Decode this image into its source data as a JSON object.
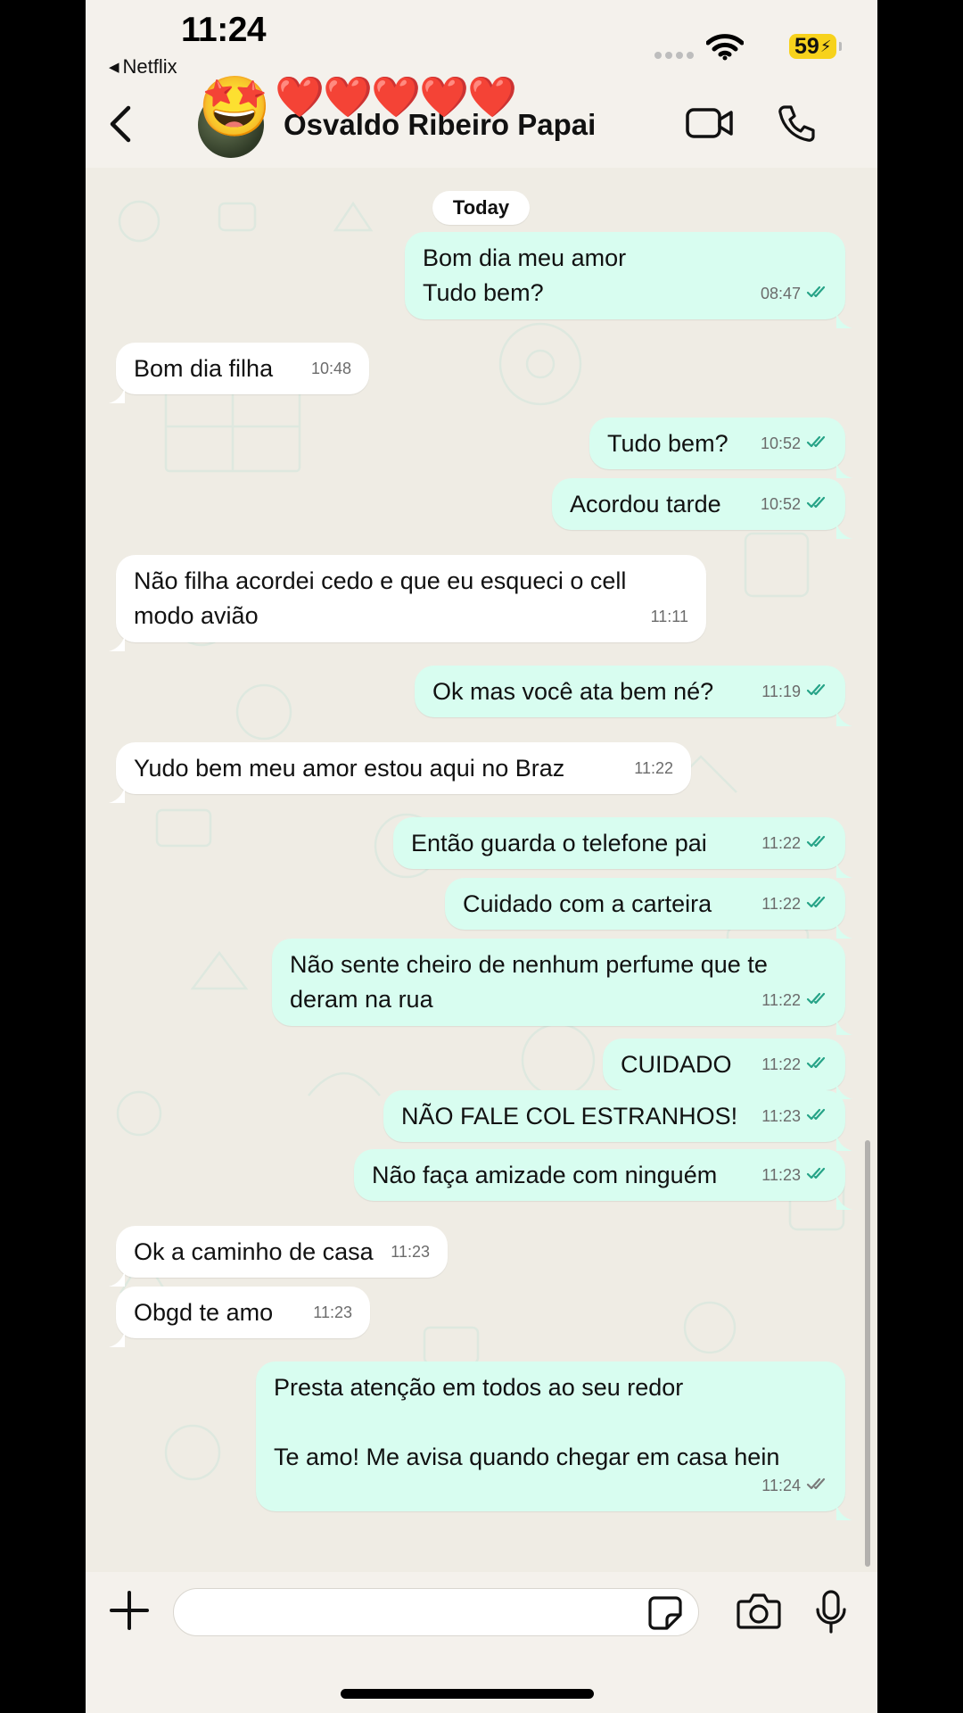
{
  "status_bar": {
    "time": "11:24",
    "back_app": "Netflix",
    "battery": "59"
  },
  "header": {
    "contact_name": "Osvaldo Ribeiro Papai",
    "hearts": "❤️❤️❤️❤️❤️",
    "avatar_emoji": "🤩"
  },
  "chat": {
    "date_label": "Today",
    "messages": [
      {
        "dir": "out",
        "lines": [
          "Bom dia meu amor",
          "Tudo bem?"
        ],
        "time": "08:47"
      },
      {
        "dir": "in",
        "lines": [
          "Bom dia filha"
        ],
        "time": "10:48"
      },
      {
        "dir": "out",
        "lines": [
          "Tudo bem?"
        ],
        "time": "10:52"
      },
      {
        "dir": "out",
        "lines": [
          "Acordou tarde"
        ],
        "time": "10:52"
      },
      {
        "dir": "in",
        "lines": [
          "Não filha acordei cedo e que eu esqueci o cell",
          "modo avião"
        ],
        "time": "11:11"
      },
      {
        "dir": "out",
        "lines": [
          "Ok mas você ata bem né?"
        ],
        "time": "11:19"
      },
      {
        "dir": "in",
        "lines": [
          "Yudo bem meu amor estou aqui no Braz"
        ],
        "time": "11:22"
      },
      {
        "dir": "out",
        "lines": [
          "Então guarda o telefone pai"
        ],
        "time": "11:22"
      },
      {
        "dir": "out",
        "lines": [
          "Cuidado com a carteira"
        ],
        "time": "11:22"
      },
      {
        "dir": "out",
        "lines": [
          "Não sente cheiro de nenhum perfume que te",
          "deram na rua"
        ],
        "time": "11:22"
      },
      {
        "dir": "out",
        "lines": [
          "CUIDADO"
        ],
        "time": "11:22"
      },
      {
        "dir": "out",
        "lines": [
          "NÃO FALE COL ESTRANHOS!"
        ],
        "time": "11:23"
      },
      {
        "dir": "out",
        "lines": [
          "Não faça amizade com ninguém"
        ],
        "time": "11:23"
      },
      {
        "dir": "in",
        "lines": [
          "Ok a caminho de casa"
        ],
        "time": "11:23"
      },
      {
        "dir": "in",
        "lines": [
          "Obgd te amo"
        ],
        "time": "11:23"
      },
      {
        "dir": "out",
        "lines": [
          "Presta atenção em todos ao seu redor",
          "",
          "Te amo! Me avisa quando chegar em casa hein"
        ],
        "time": "11:24",
        "read": false
      }
    ]
  },
  "colors": {
    "outgoing_bubble": "#D8FDF0",
    "incoming_bubble": "#FFFFFF",
    "chat_background": "#EFECE4",
    "read_ticks": "#26A387",
    "battery": "#F7D21C"
  },
  "icons": [
    "back-arrow-icon",
    "video-call-icon",
    "phone-icon",
    "plus-icon",
    "sticker-icon",
    "camera-icon",
    "microphone-icon"
  ]
}
